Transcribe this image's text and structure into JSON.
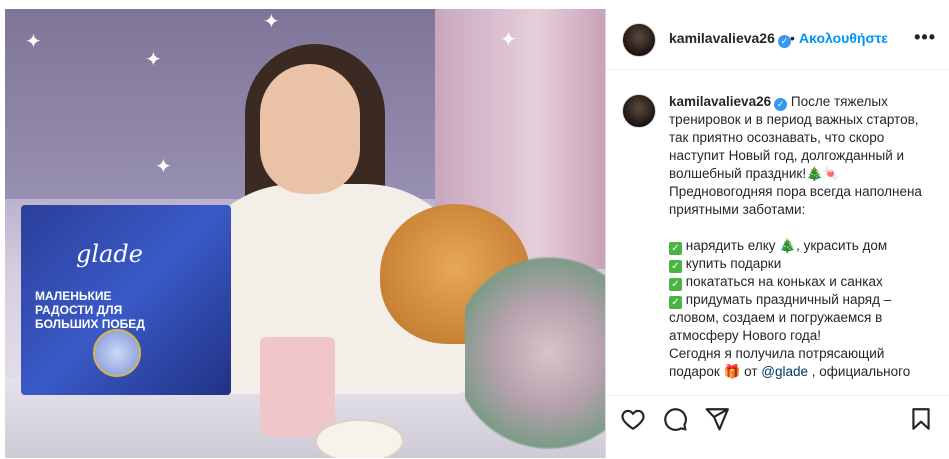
{
  "header": {
    "username": "kamilavalieva26",
    "verified_mark": "✓",
    "dot": "•",
    "follow_label": "Ακολουθήστε",
    "more_label": "•••"
  },
  "media": {
    "box_brand": "glade",
    "box_title": "МАЛЕНЬКИЕ РАДОСТИ ДЛЯ БОЛЬШИХ ПОБЕД"
  },
  "caption": {
    "username": "kamilavalieva26",
    "verified_mark": "✓",
    "line1": "После тяжелых тренировок и в период важных стартов, так приятно осознавать, что скоро наступит Новый год, долгожданный и волшебный праздник!🎄🍬 Предновогодняя пора всегда наполнена приятными заботами:",
    "checkmark": "✓",
    "items": [
      "нарядить елку 🎄, украсить дом",
      "купить подарки",
      "покататься на коньках и санках",
      "придумать праздничный наряд – словом, создаем и погружаемся в атмосферу Нового года!"
    ],
    "tail_before": "Сегодня я получила потрясающий подарок 🎁 от ",
    "tail_mention": "@glade",
    "tail_after": " , официального"
  },
  "actions": {
    "like_icon": "heart-icon",
    "comment_icon": "comment-icon",
    "share_icon": "share-icon",
    "save_icon": "bookmark-icon"
  }
}
